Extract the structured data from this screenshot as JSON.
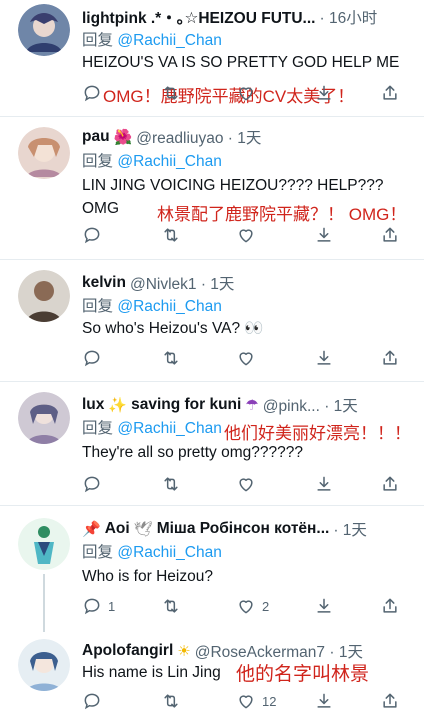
{
  "tweets": [
    {
      "name": "lightpink .*・｡☆HEIZOU FUTU...",
      "handle": "",
      "time": "· 16小时",
      "reply_prefix": "回复",
      "reply_to": "@Rachii_Chan",
      "text": "HEIZOU'S VA IS SO PRETTY GOD HELP ME",
      "annotation": "OMG！鹿野院平藏的CV太美了！"
    },
    {
      "name": "pau",
      "emoji": "🌺",
      "handle": "@readliuyao · 1天",
      "reply_prefix": "回复",
      "reply_to": "@Rachii_Chan",
      "text_line1": "LIN JING VOICING HEIZOU???? HELP???",
      "text_line2": "OMG",
      "annotation": "林景配了鹿野院平藏？！ OMG！"
    },
    {
      "name": "kelvin",
      "handle": "@Nivlek1 · 1天",
      "reply_prefix": "回复",
      "reply_to": "@Rachii_Chan",
      "text": "So who's Heizou's VA? 👀"
    },
    {
      "name": "lux",
      "emoji1": "✨",
      "name2": "saving for kuni",
      "emoji2": "☂",
      "handle": "@pink... · 1天",
      "reply_prefix": "回复",
      "reply_to": "@Rachii_Chan",
      "annotation": "他们好美丽好漂亮！！！",
      "text": "They're all so pretty omg??????"
    },
    {
      "emoji_pin": "📌",
      "name": "Aoi",
      "emoji_dove": "🕊",
      "name2": "Міша Робінсон котён...",
      "time": "· 1天",
      "reply_prefix": "回复",
      "reply_to": "@Rachii_Chan",
      "text": "Who is for Heizou?",
      "reply_count": "1",
      "like_count": "2"
    },
    {
      "name": "Apolofangirl",
      "emoji": "☀",
      "handle": "@RoseAckerman7 · 1天",
      "text": "His name is Lin Jing",
      "annotation": "他的名字叫林景",
      "like_count": "12"
    }
  ],
  "icons": [
    "reply-icon",
    "retweet-icon",
    "like-icon",
    "bookmark-icon",
    "share-icon"
  ],
  "colors": {
    "link": "#1d9bf0",
    "muted": "#536471",
    "annotation": "#d0251c",
    "divider": "#e6ecf0"
  }
}
